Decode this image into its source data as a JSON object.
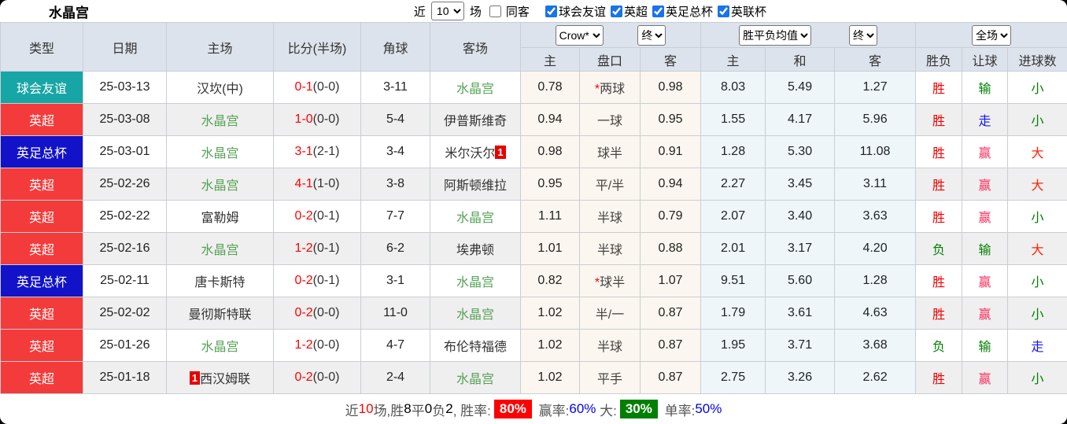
{
  "topbar": {
    "title": "水晶宫",
    "recent_label": "近",
    "recent_value": "10",
    "games_label": "场",
    "same_venue": {
      "label": "同客",
      "checked": false
    },
    "competitions": [
      {
        "label": "球会友谊",
        "checked": true
      },
      {
        "label": "英超",
        "checked": true
      },
      {
        "label": "英足总杯",
        "checked": true
      },
      {
        "label": "英联杯",
        "checked": true
      }
    ]
  },
  "table": {
    "left_headers": [
      "类型",
      "日期",
      "主场",
      "比分(半场)",
      "角球",
      "客场"
    ],
    "group1": {
      "select1": "Crow*",
      "select2": "终",
      "subheaders": [
        "主",
        "盘口",
        "客"
      ]
    },
    "group2": {
      "select1": "胜平负均值",
      "select2": "终",
      "subheaders": [
        "主",
        "和",
        "客"
      ]
    },
    "group3": {
      "select1": "全场",
      "subheaders": [
        "胜负",
        "让球",
        "进球数"
      ]
    },
    "type_colors": {
      "球会友谊": "#18a5a5",
      "英超": "#f43b3b",
      "英足总杯": "#1212c8"
    },
    "result_colors": {
      "胜": "#f00000",
      "负": "#008000",
      "赢": "#f5305d",
      "输": "#008000",
      "走": "#1414ff",
      "大": "#ff2400",
      "小": "#008000"
    },
    "rows": [
      {
        "type": "球会友谊",
        "date": "25-03-13",
        "home": {
          "name": "汉坎(中)",
          "self": false
        },
        "score": {
          "ft": "0-1",
          "ht": "(0-0)"
        },
        "corner": "3-11",
        "away": {
          "name": "水晶宫",
          "self": true
        },
        "odds": {
          "home": "0.78",
          "line": "两球",
          "line_star": true,
          "away": "0.98"
        },
        "avg": {
          "home": "8.03",
          "draw": "5.49",
          "away": "1.27"
        },
        "results": {
          "outcome": "胜",
          "handicap": "输",
          "goals": "小"
        }
      },
      {
        "type": "英超",
        "date": "25-03-08",
        "home": {
          "name": "水晶宫",
          "self": true
        },
        "score": {
          "ft": "1-0",
          "ht": "(0-0)"
        },
        "corner": "5-4",
        "away": {
          "name": "伊普斯维奇",
          "self": false
        },
        "odds": {
          "home": "0.94",
          "line": "一球",
          "line_star": false,
          "away": "0.95"
        },
        "avg": {
          "home": "1.55",
          "draw": "4.17",
          "away": "5.96"
        },
        "results": {
          "outcome": "胜",
          "handicap": "走",
          "goals": "小"
        }
      },
      {
        "type": "英足总杯",
        "date": "25-03-01",
        "home": {
          "name": "水晶宫",
          "self": true
        },
        "score": {
          "ft": "3-1",
          "ht": "(2-1)"
        },
        "corner": "3-4",
        "away": {
          "name": "米尔沃尔",
          "self": false,
          "badge": {
            "text": "1",
            "pos": "after"
          }
        },
        "odds": {
          "home": "0.98",
          "line": "球半",
          "line_star": false,
          "away": "0.91"
        },
        "avg": {
          "home": "1.28",
          "draw": "5.30",
          "away": "11.08"
        },
        "results": {
          "outcome": "胜",
          "handicap": "赢",
          "goals": "大"
        }
      },
      {
        "type": "英超",
        "date": "25-02-26",
        "home": {
          "name": "水晶宫",
          "self": true
        },
        "score": {
          "ft": "4-1",
          "ht": "(1-0)"
        },
        "corner": "3-8",
        "away": {
          "name": "阿斯顿维拉",
          "self": false
        },
        "odds": {
          "home": "0.95",
          "line": "平/半",
          "line_star": false,
          "away": "0.94"
        },
        "avg": {
          "home": "2.27",
          "draw": "3.45",
          "away": "3.11"
        },
        "results": {
          "outcome": "胜",
          "handicap": "赢",
          "goals": "大"
        }
      },
      {
        "type": "英超",
        "date": "25-02-22",
        "home": {
          "name": "富勒姆",
          "self": false
        },
        "score": {
          "ft": "0-2",
          "ht": "(0-1)"
        },
        "corner": "7-7",
        "away": {
          "name": "水晶宫",
          "self": true
        },
        "odds": {
          "home": "1.11",
          "line": "半球",
          "line_star": false,
          "away": "0.79"
        },
        "avg": {
          "home": "2.07",
          "draw": "3.40",
          "away": "3.63"
        },
        "results": {
          "outcome": "胜",
          "handicap": "赢",
          "goals": "小"
        }
      },
      {
        "type": "英超",
        "date": "25-02-16",
        "home": {
          "name": "水晶宫",
          "self": true
        },
        "score": {
          "ft": "1-2",
          "ht": "(0-1)"
        },
        "corner": "6-2",
        "away": {
          "name": "埃弗顿",
          "self": false
        },
        "odds": {
          "home": "1.01",
          "line": "半球",
          "line_star": false,
          "away": "0.88"
        },
        "avg": {
          "home": "2.01",
          "draw": "3.17",
          "away": "4.20"
        },
        "results": {
          "outcome": "负",
          "handicap": "输",
          "goals": "大"
        }
      },
      {
        "type": "英足总杯",
        "date": "25-02-11",
        "home": {
          "name": "唐卡斯特",
          "self": false
        },
        "score": {
          "ft": "0-2",
          "ht": "(0-1)"
        },
        "corner": "3-1",
        "away": {
          "name": "水晶宫",
          "self": true
        },
        "odds": {
          "home": "0.82",
          "line": "球半",
          "line_star": true,
          "away": "1.07"
        },
        "avg": {
          "home": "9.51",
          "draw": "5.60",
          "away": "1.28"
        },
        "results": {
          "outcome": "胜",
          "handicap": "赢",
          "goals": "小"
        }
      },
      {
        "type": "英超",
        "date": "25-02-02",
        "home": {
          "name": "曼彻斯特联",
          "self": false
        },
        "score": {
          "ft": "0-2",
          "ht": "(0-0)"
        },
        "corner": "11-0",
        "away": {
          "name": "水晶宫",
          "self": true
        },
        "odds": {
          "home": "1.02",
          "line": "半/一",
          "line_star": false,
          "away": "0.87"
        },
        "avg": {
          "home": "1.79",
          "draw": "3.61",
          "away": "4.63"
        },
        "results": {
          "outcome": "胜",
          "handicap": "赢",
          "goals": "小"
        }
      },
      {
        "type": "英超",
        "date": "25-01-26",
        "home": {
          "name": "水晶宫",
          "self": true
        },
        "score": {
          "ft": "1-2",
          "ht": "(0-0)"
        },
        "corner": "4-7",
        "away": {
          "name": "布伦特福德",
          "self": false
        },
        "odds": {
          "home": "1.02",
          "line": "半球",
          "line_star": false,
          "away": "0.87"
        },
        "avg": {
          "home": "1.95",
          "draw": "3.71",
          "away": "3.68"
        },
        "results": {
          "outcome": "负",
          "handicap": "输",
          "goals": "走"
        }
      },
      {
        "type": "英超",
        "date": "25-01-18",
        "home": {
          "name": "西汉姆联",
          "self": false,
          "badge": {
            "text": "1",
            "pos": "before"
          }
        },
        "score": {
          "ft": "0-2",
          "ht": "(0-0)"
        },
        "corner": "2-4",
        "away": {
          "name": "水晶宫",
          "self": true
        },
        "odds": {
          "home": "1.02",
          "line": "平手",
          "line_star": false,
          "away": "0.87"
        },
        "avg": {
          "home": "2.75",
          "draw": "3.26",
          "away": "2.62"
        },
        "results": {
          "outcome": "胜",
          "handicap": "赢",
          "goals": "小"
        }
      }
    ]
  },
  "summary": {
    "segments": [
      {
        "text": "近",
        "style": "plain"
      },
      {
        "text": "10",
        "style": "red"
      },
      {
        "text": "场,胜",
        "style": "plain"
      },
      {
        "text": "8",
        "style": "num"
      },
      {
        "text": "平",
        "style": "plain"
      },
      {
        "text": "0",
        "style": "num"
      },
      {
        "text": "负",
        "style": "plain"
      },
      {
        "text": "2",
        "style": "num"
      },
      {
        "text": ", 胜率:",
        "style": "plain"
      },
      {
        "text": "80%",
        "style": "badge-red"
      },
      {
        "text": " 赢率:",
        "style": "plain"
      },
      {
        "text": "60%",
        "style": "blue"
      },
      {
        "text": " 大:",
        "style": "plain"
      },
      {
        "text": "30%",
        "style": "badge-green"
      },
      {
        "text": " 单率:",
        "style": "plain"
      },
      {
        "text": "50%",
        "style": "blue"
      }
    ]
  }
}
